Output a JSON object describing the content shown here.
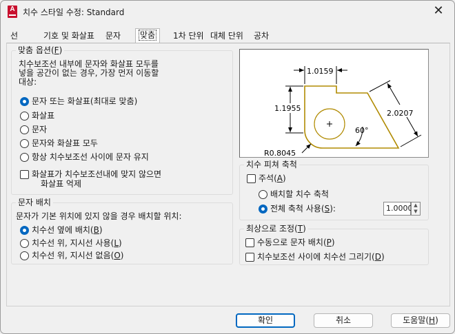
{
  "window": {
    "title": "치수 스타일 수정: Standard",
    "close_glyph": "✕",
    "app_icon_letter": "A"
  },
  "tabs": [
    {
      "label": "선"
    },
    {
      "label": "기호 및 화살표"
    },
    {
      "label": "문자"
    },
    {
      "label": "맞춤"
    },
    {
      "label": "1차 단위"
    },
    {
      "label": "대체 단위"
    },
    {
      "label": "공차"
    }
  ],
  "fit_options": {
    "title": "맞춤 옵션(F)",
    "title_pre": "맞춤 옵션(",
    "title_key": "F",
    "title_post": ")",
    "description": [
      "치수보조선 내부에 문자와 화살표 모두를",
      "넣을 공간이 없는 경우, 가장 먼저 이동할",
      "대상:"
    ],
    "radios": [
      {
        "label": "문자 또는 화살표(최대로 맞춤)",
        "checked": true
      },
      {
        "label": "화살표",
        "checked": false
      },
      {
        "label": "문자",
        "checked": false
      },
      {
        "label": "문자와 화살표 모두",
        "checked": false
      },
      {
        "label": "항상 치수보조선 사이에 문자 유지",
        "checked": false
      }
    ],
    "suppress_check": {
      "line1": "화살표가 치수보조선내에 맞지 않으면",
      "line2": "화살표 억제",
      "checked": false
    }
  },
  "text_placement": {
    "title": "문자 배치",
    "description": "문자가 기본 위치에 있지 않을 경우 배치할 위치:",
    "radios": [
      {
        "label": "치수선 옆에 배치(B)",
        "pre": "치수선 옆에 배치(",
        "key": "B",
        "post": ")",
        "checked": true
      },
      {
        "label": "치수선 위, 지시선 사용(L)",
        "pre": "치수선 위, 지시선 사용(",
        "key": "L",
        "post": ")",
        "checked": false
      },
      {
        "label": "치수선 위, 지시선 없음(O)",
        "pre": "치수선 위, 지시선 없음(",
        "key": "O",
        "post": ")",
        "checked": false
      }
    ]
  },
  "preview": {
    "dim_top": "1.0159",
    "dim_left": "1.1955",
    "dim_right": "2.0207",
    "angle": "60°",
    "radius": "R0.8045",
    "line_color": "#b08a00"
  },
  "scale": {
    "title": "치수 피쳐 축척",
    "annotative": {
      "label": "주석(A)",
      "pre": "주석(",
      "key": "A",
      "post": ")",
      "checked": false
    },
    "layout_radio": {
      "label": "배치할 치수 축척",
      "checked": false
    },
    "overall_radio": {
      "label": "전체 축척 사용(S):",
      "pre": "전체 축척 사용(",
      "key": "S",
      "post": "):",
      "checked": true
    },
    "overall_value": "1.0000",
    "spin_up": "▲",
    "spin_down": "▼"
  },
  "fine_tuning": {
    "title": "최상으로 조정(T)",
    "title_pre": "최상으로 조정(",
    "title_key": "T",
    "title_post": ")",
    "checks": [
      {
        "label": "수동으로 문자 배치(P)",
        "pre": "수동으로 문자 배치(",
        "key": "P",
        "post": ")",
        "checked": false
      },
      {
        "label": "치수보조선 사이에 치수선 그리기(D)",
        "pre": "치수보조선 사이에 치수선 그리기(",
        "key": "D",
        "post": ")",
        "checked": false
      }
    ]
  },
  "buttons": {
    "ok": "확인",
    "cancel": "취소",
    "help_pre": "도움말(",
    "help_key": "H",
    "help_post": ")"
  },
  "colors": {
    "accent": "#0067c0",
    "preview_geometry": "#b08a00"
  }
}
